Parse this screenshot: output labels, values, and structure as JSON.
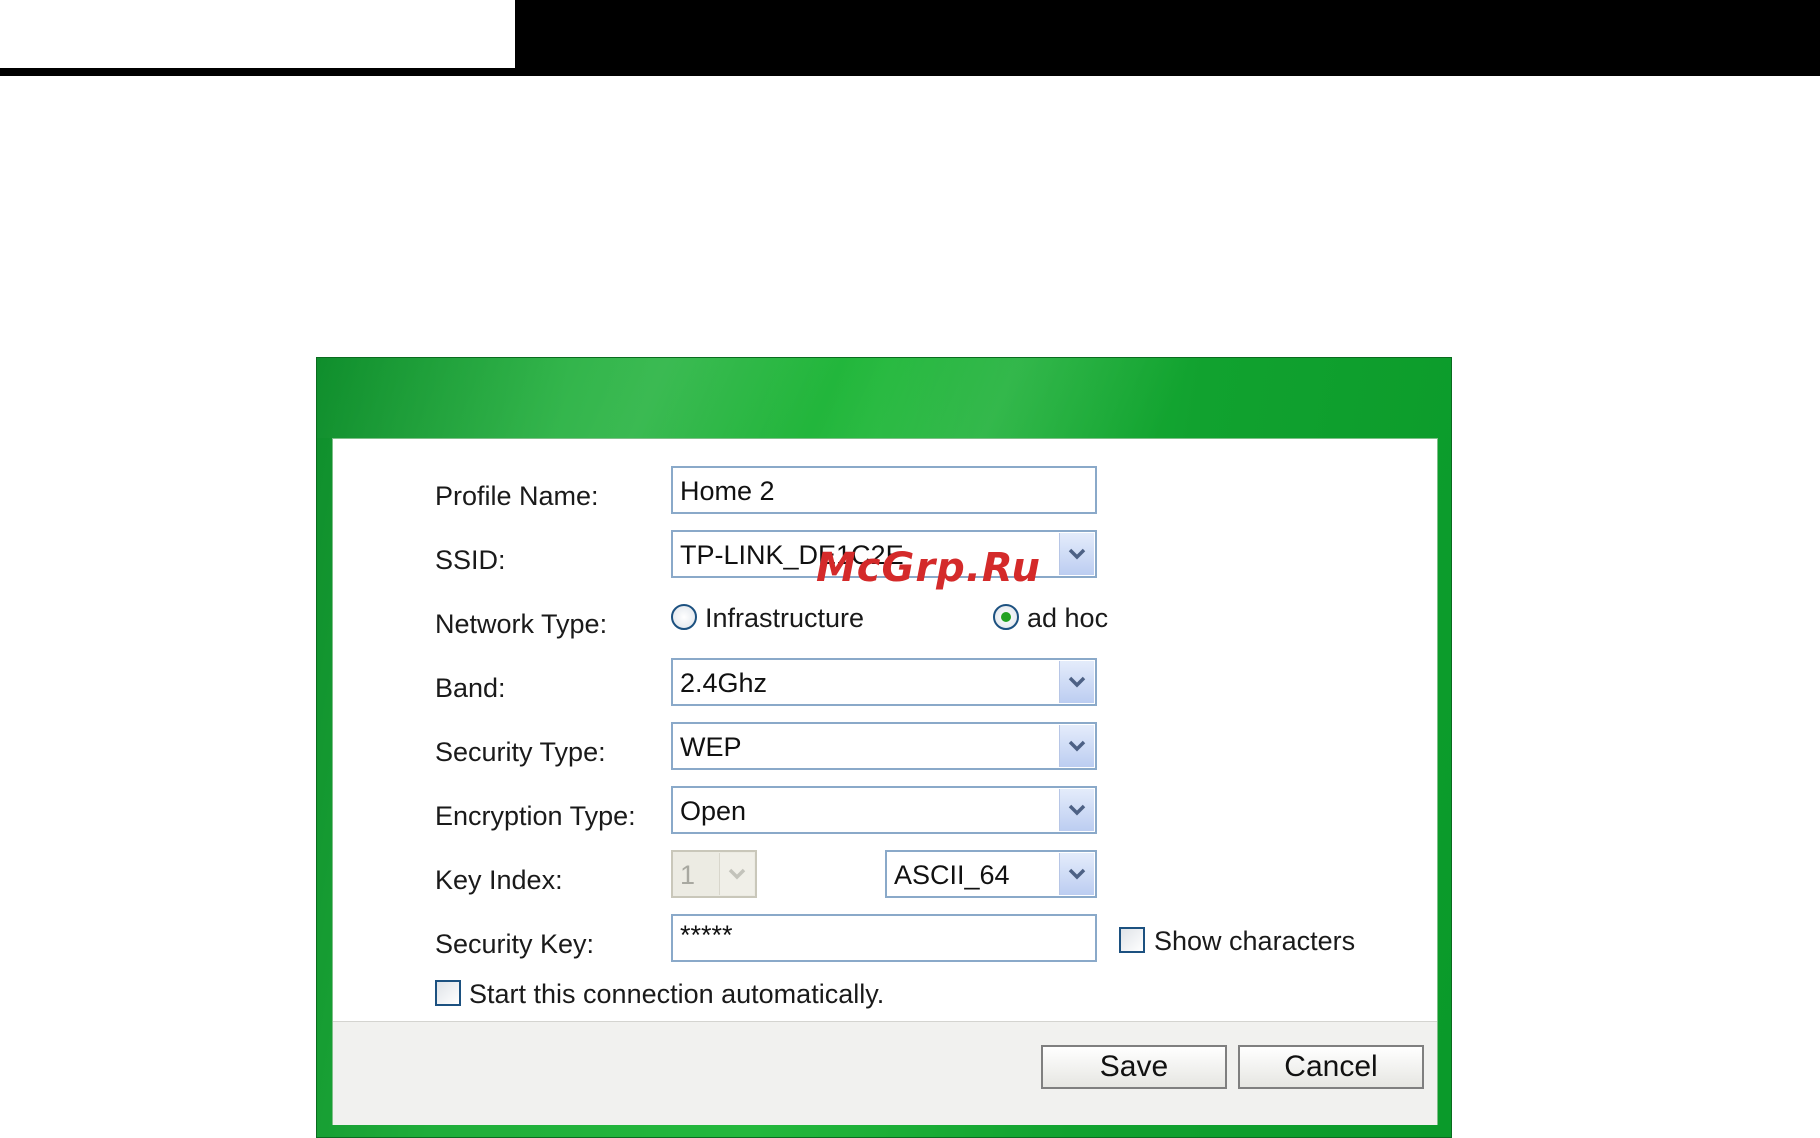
{
  "form": {
    "profile_name_label": "Profile Name:",
    "profile_name_value": "Home 2",
    "ssid_label": "SSID:",
    "ssid_value": "TP-LINK_DE1C2E",
    "network_type_label": "Network Type:",
    "network_type_options": [
      "Infrastructure",
      "ad hoc"
    ],
    "network_type_selected": "ad hoc",
    "band_label": "Band:",
    "band_value": "2.4Ghz",
    "security_type_label": "Security Type:",
    "security_type_value": "WEP",
    "encryption_type_label": "Encryption Type:",
    "encryption_type_value": "Open",
    "key_index_label": "Key Index:",
    "key_index_value": "1",
    "key_format_value": "ASCII_64",
    "security_key_label": "Security Key:",
    "security_key_value": "*****",
    "show_characters_label": "Show characters",
    "show_characters_checked": false,
    "auto_connect_label": "Start this connection automatically.",
    "auto_connect_checked": false
  },
  "buttons": {
    "save_label": "Save",
    "cancel_label": "Cancel"
  },
  "watermark": "McGrp.Ru",
  "colors": {
    "dialog_green": "#1fae3a",
    "field_border": "#8aa9c9",
    "radio_dot": "#21a121",
    "watermark": "#d42a2a"
  }
}
